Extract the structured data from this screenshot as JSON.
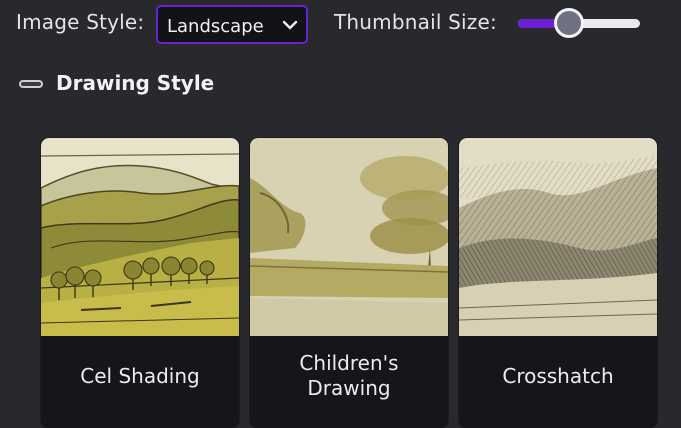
{
  "toolbar": {
    "image_style_label": "Image Style:",
    "image_style_value": "Landscape",
    "thumbnail_size_label": "Thumbnail Size:",
    "thumbnail_size_fraction": 0.42
  },
  "section": {
    "title": "Drawing Style"
  },
  "cards": [
    {
      "label": "Cel Shading",
      "image": "cel-shaded-landscape-thumbnail"
    },
    {
      "label": "Children's\nDrawing",
      "image": "childrens-drawing-landscape-thumbnail"
    },
    {
      "label": "Crosshatch",
      "image": "crosshatch-landscape-thumbnail"
    }
  ],
  "colors": {
    "accent": "#6d1fd6",
    "background": "#27292c",
    "card": "#15161a"
  }
}
